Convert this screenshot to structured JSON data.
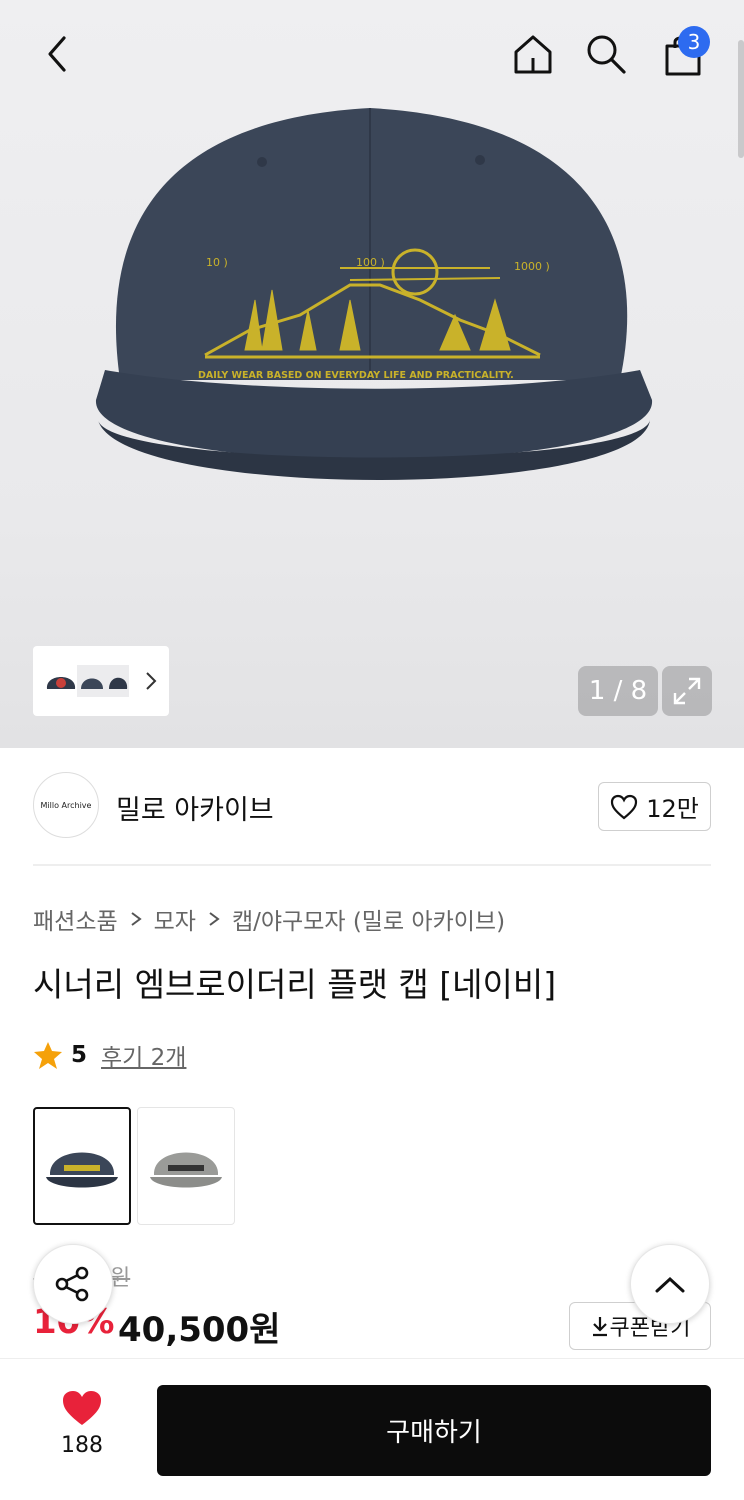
{
  "header": {
    "cart_count": "3",
    "icons": {
      "back": "chevron-left-icon",
      "home": "home-icon",
      "search": "search-icon",
      "cart": "shopping-bag-icon"
    }
  },
  "gallery": {
    "counter": "1 / 8",
    "main_image": "navy cap embroidered with mountain scene",
    "embroidery": {
      "marks": [
        "10 )",
        "100 )",
        "1000 )"
      ],
      "tagline": "DAILY WEAR BASED ON EVERYDAY LIFE AND PRACTICALITY."
    },
    "colors": {
      "cap": "#3b4658",
      "embroidery": "#c9b22a"
    }
  },
  "brand": {
    "logo_text": "Millo Archive",
    "name": "밀로 아카이브",
    "likes": "12만"
  },
  "breadcrumb": [
    "패션소품",
    "모자",
    "캡/야구모자 (밀로 아카이브)"
  ],
  "product": {
    "title": "시너리 엠브로이더리 플랫 캡 [네이비]",
    "rating": "5",
    "review_link": "후기 2개",
    "options": [
      {
        "color": "navy",
        "selected": true
      },
      {
        "color": "gray",
        "selected": false
      }
    ]
  },
  "price": {
    "original": "45,000원",
    "discount": "10%",
    "final": "40,500원",
    "coupon_label": "쿠폰받기"
  },
  "bottom": {
    "wish_count": "188",
    "buy_label": "구매하기"
  },
  "colors": {
    "accent": "#e8223a",
    "badge": "#2d6bf0",
    "buy_bg": "#0c0c0c"
  }
}
